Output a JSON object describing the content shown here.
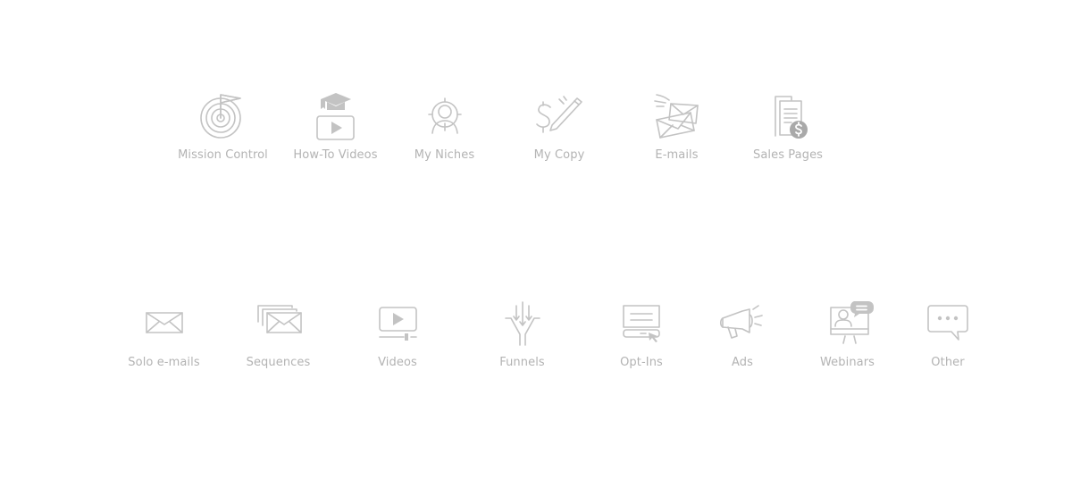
{
  "colors": {
    "icon": "#c3c3c3",
    "label": "#b3b3b3",
    "background": "#ffffff"
  },
  "row1": [
    {
      "label": "Mission Control",
      "icon": "target-flag-icon"
    },
    {
      "label": "How-To Videos",
      "icon": "graduation-video-icon"
    },
    {
      "label": "My Niches",
      "icon": "target-person-icon"
    },
    {
      "label": "My Copy",
      "icon": "dollar-pencil-icon"
    },
    {
      "label": "E-mails",
      "icon": "flying-envelopes-icon"
    },
    {
      "label": "Sales Pages",
      "icon": "documents-dollar-icon"
    }
  ],
  "row2": [
    {
      "label": "Solo e-mails",
      "icon": "envelope-icon"
    },
    {
      "label": "Sequences",
      "icon": "stacked-envelopes-icon"
    },
    {
      "label": "Videos",
      "icon": "video-player-icon"
    },
    {
      "label": "Funnels",
      "icon": "funnel-icon"
    },
    {
      "label": "Opt-Ins",
      "icon": "optin-form-icon"
    },
    {
      "label": "Ads",
      "icon": "megaphone-icon"
    },
    {
      "label": "Webinars",
      "icon": "webinar-icon"
    },
    {
      "label": "Other",
      "icon": "chat-bubble-icon"
    }
  ]
}
